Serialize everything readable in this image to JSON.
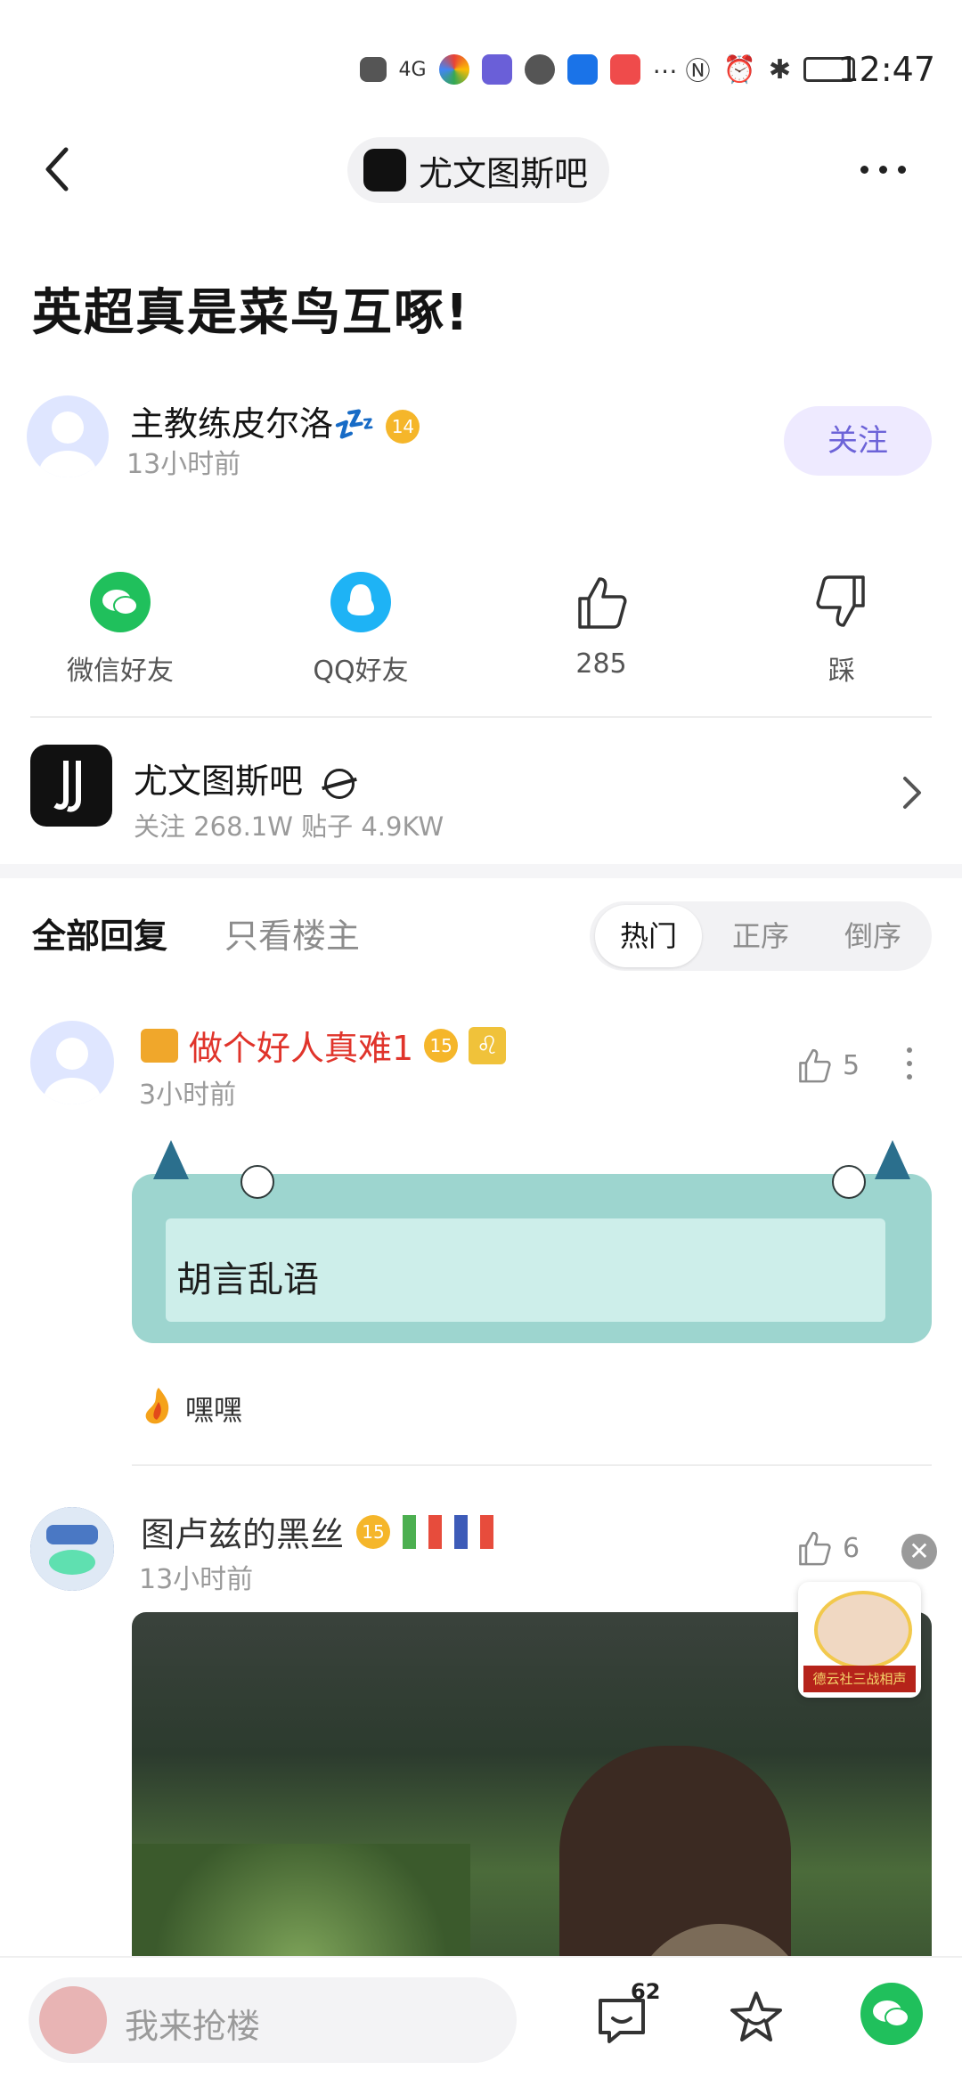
{
  "status_bar": {
    "time": "12:47",
    "network": "4G"
  },
  "nav": {
    "forum_name": "尤文图斯吧"
  },
  "post": {
    "title": "英超真是菜鸟互啄!",
    "author": {
      "name": "主教练皮尔洛💤",
      "level": "14",
      "time": "13小时前"
    },
    "follow_label": "关注"
  },
  "share": {
    "wechat": "微信好友",
    "qq": "QQ好友",
    "like_count": "285",
    "dislike": "踩"
  },
  "forum": {
    "name": "尤文图斯吧",
    "stats": "关注 268.1W   贴子 4.9KW"
  },
  "tabs": {
    "all": "全部回复",
    "host_only": "只看楼主"
  },
  "sort": {
    "hot": "热门",
    "asc": "正序",
    "desc": "倒序"
  },
  "replies": [
    {
      "name": "做个好人真难1",
      "level": "15",
      "time": "3小时前",
      "likes": "5",
      "text": "胡言乱语",
      "tail": "嘿嘿"
    },
    {
      "name": "图卢兹的黑丝",
      "level": "15",
      "time": "13小时前",
      "likes": "6"
    }
  ],
  "ad": {
    "banner": "德云社三战相声"
  },
  "bottom": {
    "placeholder": "我来抢楼",
    "comment_count": "62"
  },
  "colors": {
    "accent": "#6c63d8",
    "wechat": "#20c05c",
    "qq": "#1eb3f5",
    "red_name": "#e0342b"
  }
}
